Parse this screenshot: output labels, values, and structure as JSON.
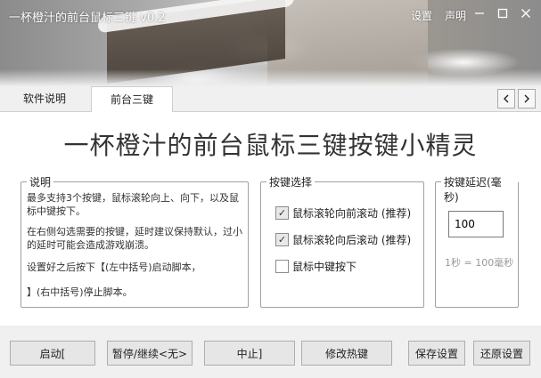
{
  "window": {
    "title": "一杯橙汁的前台鼠标三键 v0.2",
    "links": {
      "settings": "设置",
      "about": "声明"
    },
    "controls": {
      "minimize": "—",
      "maximize": "☐",
      "close": "✕"
    }
  },
  "tabs": [
    {
      "label": "软件说明",
      "active": false
    },
    {
      "label": "前台三键",
      "active": true
    }
  ],
  "tab_scroll": {
    "left": "‹",
    "right": "›"
  },
  "main": {
    "headline": "一杯橙汁的前台鼠标三键按键小精灵",
    "description": {
      "title": "说明",
      "p1": "最多支持3个按键，鼠标滚轮向上、向下，以及鼠标中键按下。",
      "p2": "在右侧勾选需要的按键，延时建议保持默认，过小的延时可能会造成游戏崩溃。",
      "p3": "设置好之后按下【(左中括号)启动脚本，",
      "p4": "】(右中括号)停止脚本。"
    },
    "key_select": {
      "title": "按键选择",
      "options": [
        {
          "label": "鼠标滚轮向前滚动 (推荐)",
          "checked": true
        },
        {
          "label": "鼠标滚轮向后滚动 (推荐)",
          "checked": true
        },
        {
          "label": "鼠标中键按下",
          "checked": false
        }
      ]
    },
    "delay": {
      "title": "按键延迟(毫秒)",
      "value": "100",
      "note": "1秒 = 100毫秒"
    }
  },
  "buttons": {
    "start": "启动[",
    "pause": "暂停/继续<无>",
    "stop": "中止]",
    "hotkey": "修改热键",
    "save": "保存设置",
    "restore": "还原设置"
  }
}
